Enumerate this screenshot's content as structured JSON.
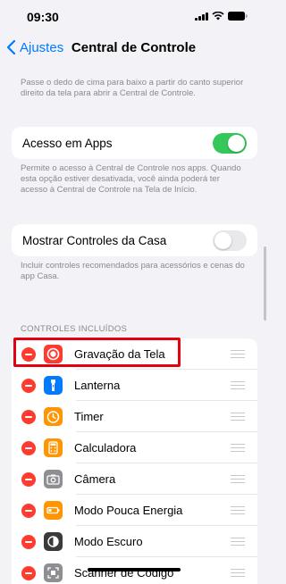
{
  "status": {
    "time": "09:30"
  },
  "nav": {
    "back_label": "Ajustes",
    "title": "Central de Controle"
  },
  "intro_text": "Passe o dedo de cima para baixo a partir do canto superior direito da tela para abrir a Central de Controle.",
  "access_in_apps": {
    "label": "Acesso em Apps",
    "enabled": true,
    "description": "Permite o acesso à Central de Controle nos apps. Quando esta opção estiver desativada, você ainda poderá ter acesso à Central de Controle na Tela de Início."
  },
  "home_controls": {
    "label": "Mostrar Controles da Casa",
    "enabled": false,
    "description": "Incluir controles recomendados para acessórios e cenas do app Casa."
  },
  "included_controls": {
    "header": "CONTROLES INCLUÍDOS",
    "items": [
      {
        "label": "Gravação da Tela",
        "icon": "screen-recording-icon",
        "color": "#ff3b30"
      },
      {
        "label": "Lanterna",
        "icon": "flashlight-icon",
        "color": "#007aff"
      },
      {
        "label": "Timer",
        "icon": "timer-icon",
        "color": "#ff9500"
      },
      {
        "label": "Calculadora",
        "icon": "calculator-icon",
        "color": "#ff9500"
      },
      {
        "label": "Câmera",
        "icon": "camera-icon",
        "color": "#8e8e93"
      },
      {
        "label": "Modo Pouca Energia",
        "icon": "low-power-icon",
        "color": "#ff9500"
      },
      {
        "label": "Modo Escuro",
        "icon": "dark-mode-icon",
        "color": "#3a3a3c"
      },
      {
        "label": "Scanner de Código",
        "icon": "code-scanner-icon",
        "color": "#8e8e93"
      }
    ]
  },
  "colors": {
    "accent": "#007aff",
    "toggle_on": "#34c759",
    "toggle_off": "#e9e9eb",
    "remove": "#ff3b30",
    "highlight": "#e3000f"
  }
}
